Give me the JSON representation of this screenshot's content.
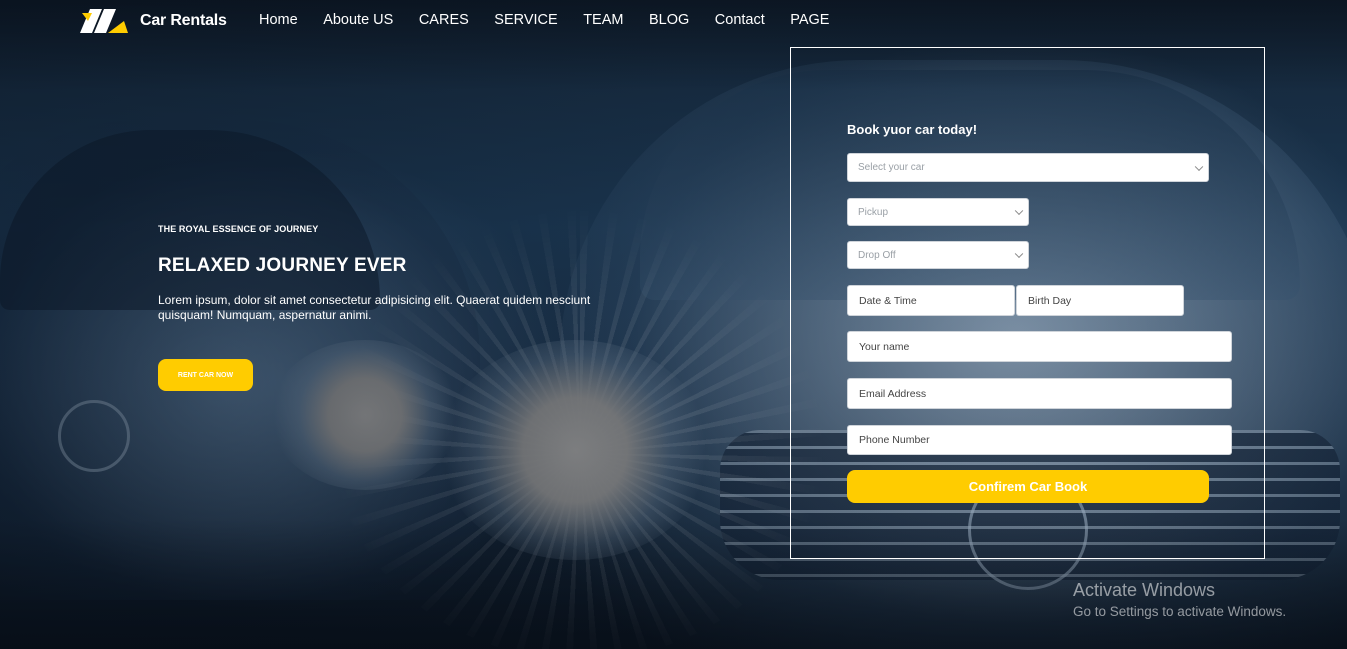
{
  "brand": {
    "name": "Car Rentals",
    "logo_icon": "car-rentals-logo-icon"
  },
  "nav": {
    "items": [
      {
        "label": "Home"
      },
      {
        "label": "Aboute US"
      },
      {
        "label": "CARES"
      },
      {
        "label": "SERVICE"
      },
      {
        "label": "TEAM"
      },
      {
        "label": "BLOG"
      },
      {
        "label": "Contact"
      },
      {
        "label": "PAGE"
      }
    ]
  },
  "hero": {
    "eyebrow": "THE ROYAL ESSENCE OF JOURNEY",
    "title": "RELAXED JOURNEY EVER",
    "description": "Lorem ipsum, dolor sit amet consectetur adipisicing elit. Quaerat quidem nesciunt quisquam! Numquam, aspernatur animi.",
    "cta_label": "RENT CAR NOW"
  },
  "booking": {
    "title": "Book yuor car today!",
    "car_select": "Select your car",
    "pickup_select": "Pickup",
    "dropoff_select": "Drop Off",
    "date_time_placeholder": "Date & Time",
    "birthday_placeholder": "Birth Day",
    "name_placeholder": "Your name",
    "email_placeholder": "Email Address",
    "phone_placeholder": "Phone Number",
    "confirm_label": "Confirem Car Book"
  },
  "watermark": {
    "title": "Activate Windows",
    "subtitle": "Go to Settings to activate Windows."
  },
  "colors": {
    "accent": "#ffcc00",
    "background": "#1d3a56",
    "text": "#ffffff"
  }
}
